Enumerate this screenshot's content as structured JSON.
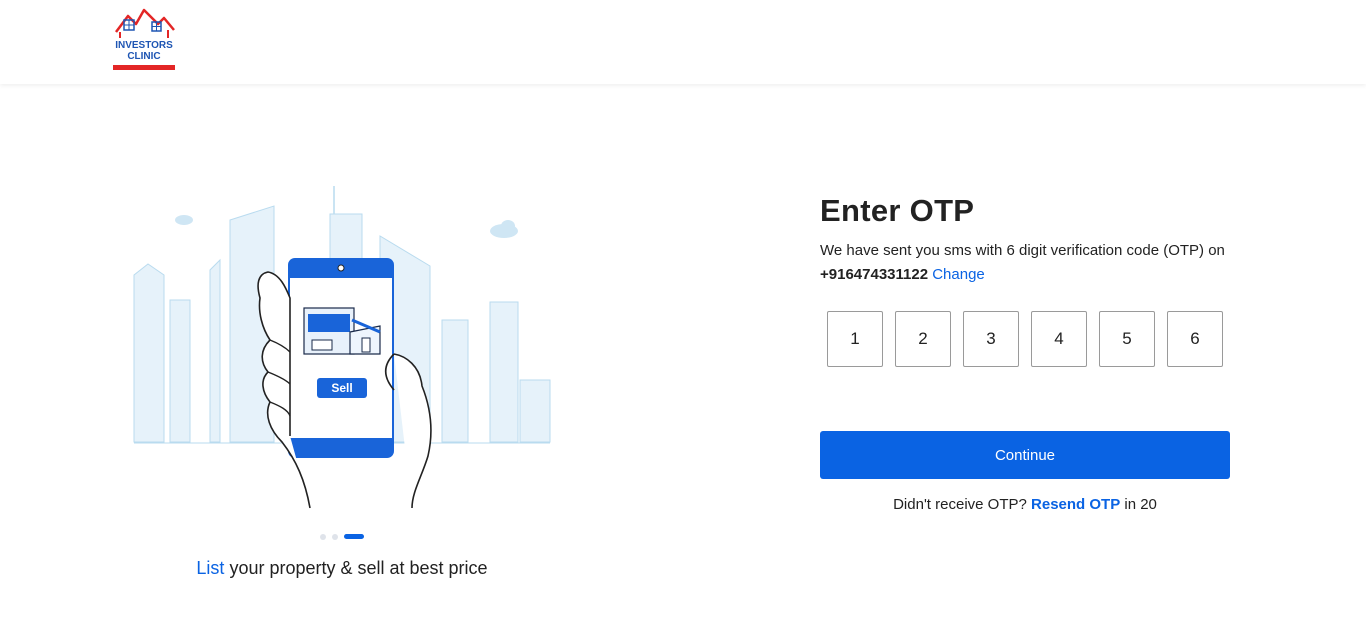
{
  "header": {
    "logo_text": "INVESTORS CLINIC"
  },
  "carousel": {
    "illustration_label": "Sell",
    "caption_highlight": "List",
    "caption_rest": " your property & sell at best price",
    "active_slide": 3,
    "total_slides": 3
  },
  "otp": {
    "title": "Enter OTP",
    "subtitle_text": "We have sent you sms with 6 digit verification code (OTP) on ",
    "phone": "+916474331122",
    "change_label": "Change",
    "digits": [
      "1",
      "2",
      "3",
      "4",
      "5",
      "6"
    ],
    "continue_label": "Continue",
    "resend_prefix": "Didn't receive OTP? ",
    "resend_label": "Resend OTP",
    "resend_suffix": " in 20"
  },
  "colors": {
    "accent": "#0a63e3",
    "brand_red": "#e32626"
  }
}
